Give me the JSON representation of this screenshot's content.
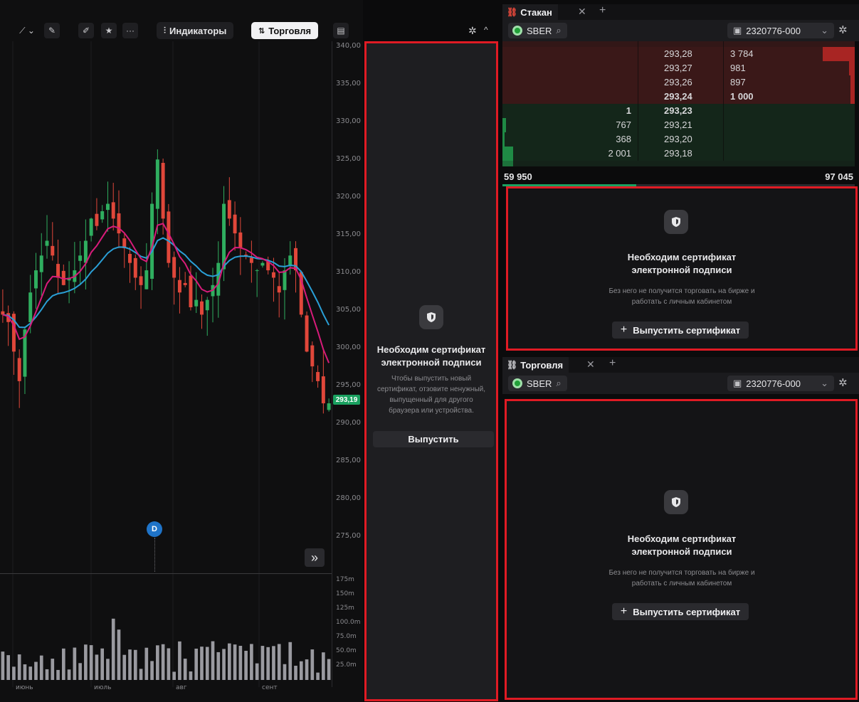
{
  "chart_toolbar": {
    "indicators_label": "Индикаторы",
    "trading_label": "Торговля",
    "more_label": "···",
    "collapse_label": "^"
  },
  "price_axis": [
    "340,00",
    "335,00",
    "330,00",
    "325,00",
    "320,00",
    "315,00",
    "310,00",
    "305,00",
    "300,00",
    "295,00",
    "290,00",
    "285,00",
    "280,00",
    "275,00"
  ],
  "last_price": "293,19",
  "volume_axis": [
    "175m",
    "150m",
    "125m",
    "100.0m",
    "75.0m",
    "50.0m",
    "25.0m"
  ],
  "month_labels": [
    "июнь",
    "июль",
    "авг",
    "сент"
  ],
  "dividend_marker": "D",
  "scroll_right_label": "»",
  "certificate_middle": {
    "title": "Необходим сертификат электронной подписи",
    "description": "Чтобы выпустить новый сертификат, отзовите ненужный, выпущенный для другого браузера или устройства.",
    "button": "Выпустить"
  },
  "order_book_widget": {
    "tab_label": "Стакан",
    "ticker": "SBER",
    "account": "2320776-000",
    "asks": [
      {
        "price": "293,28",
        "volume": "3 784",
        "bar": 0.3
      },
      {
        "price": "293,27",
        "volume": "981",
        "bar": 0.04
      },
      {
        "price": "293,26",
        "volume": "897",
        "bar": 0.03
      },
      {
        "price": "293,24",
        "volume": "1 000",
        "bar": 0.03,
        "bold": true
      }
    ],
    "bids": [
      {
        "price": "293,23",
        "volume": "1",
        "bar": 0,
        "bold": true
      },
      {
        "price": "293,21",
        "volume": "767",
        "bar": 0.03
      },
      {
        "price": "293,20",
        "volume": "368",
        "bar": 0.02
      },
      {
        "price": "293,18",
        "volume": "2 001",
        "bar": 0.07
      }
    ],
    "total_bids": "59 950",
    "total_asks": "97 045",
    "bid_share": 0.38
  },
  "certificate_orderbook": {
    "title": "Необходим сертификат электронной подписи",
    "description": "Без него не получится торговать на бирже и работать с личным кабинетом",
    "button": "Выпустить сертификат"
  },
  "trading_widget": {
    "tab_label": "Торговля",
    "ticker": "SBER",
    "account": "2320776-000"
  },
  "certificate_trading": {
    "title": "Необходим сертификат электронной подписи",
    "description": "Без него не получится торговать на бирже и работать с личным кабинетом",
    "button": "Выпустить сертификат"
  },
  "colors": {
    "up": "#2fae5f",
    "down": "#e0473a",
    "ema_fast": "#d81b7a",
    "ema_slow": "#2a9fd6",
    "highlight_border": "#e01b24"
  },
  "chart_data": {
    "type": "candlestick",
    "ticker": "SBER",
    "price_range": [
      270,
      342
    ],
    "volume_range": [
      0,
      175
    ],
    "months": [
      "июнь",
      "июль",
      "авг",
      "сент"
    ],
    "close_series": [
      305,
      304,
      300,
      296,
      303,
      308,
      311,
      313,
      315,
      313,
      310,
      309,
      310,
      311,
      313,
      315,
      318,
      317,
      319,
      320,
      318,
      316,
      314,
      312,
      310,
      309,
      311,
      320,
      326,
      318,
      312,
      310,
      308,
      309,
      306,
      307,
      305,
      307,
      309,
      312,
      320,
      318,
      316,
      314,
      313,
      312,
      311,
      312,
      311,
      310,
      308,
      311,
      313,
      311,
      305,
      300,
      298,
      296,
      293,
      293
    ]
  }
}
